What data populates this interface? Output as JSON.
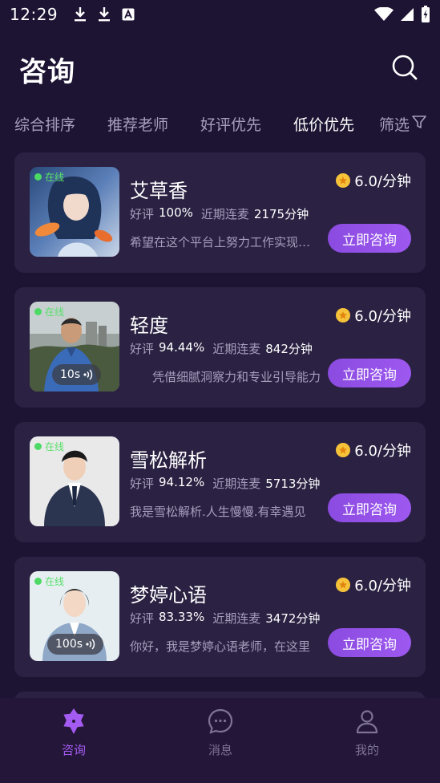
{
  "status_bar": {
    "time": "12:29",
    "left_icons": [
      "download-icon",
      "download-icon",
      "font-icon"
    ],
    "right_icons": [
      "wifi-icon",
      "signal-icon",
      "battery-charging-icon"
    ]
  },
  "header": {
    "title": "咨询",
    "search_icon": "search-icon"
  },
  "tabs": [
    {
      "label": "综合排序",
      "active": false
    },
    {
      "label": "推荐老师",
      "active": false
    },
    {
      "label": "好评优先",
      "active": false
    },
    {
      "label": "低价优先",
      "active": true
    }
  ],
  "filter": {
    "label": "筛选",
    "icon": "filter-icon"
  },
  "consultants": [
    {
      "name": "艾草香",
      "online_label": "在线",
      "price": "6.0/分钟",
      "rating_label": "好评",
      "rating": "100%",
      "streak_label": "近期连麦",
      "streak": "2175分钟",
      "description": "希望在这个平台上努力工作实现自我价值",
      "button": "立即咨询"
    },
    {
      "name": "轻度",
      "online_label": "在线",
      "audio": "10s",
      "price": "6.0/分钟",
      "rating_label": "好评",
      "rating": "94.44%",
      "streak_label": "近期连麦",
      "streak": "842分钟",
      "description": "凭借细腻洞察力和专业引导能力",
      "button": "立即咨询"
    },
    {
      "name": "雪松解析",
      "online_label": "在线",
      "price": "6.0/分钟",
      "rating_label": "好评",
      "rating": "94.12%",
      "streak_label": "近期连麦",
      "streak": "5713分钟",
      "description": "我是雪松解析.人生慢慢.有幸遇见",
      "button": "立即咨询"
    },
    {
      "name": "梦婷心语",
      "online_label": "在线",
      "audio": "100s",
      "price": "6.0/分钟",
      "rating_label": "好评",
      "rating": "83.33%",
      "streak_label": "近期连麦",
      "streak": "3472分钟",
      "description": "你好，我是梦婷心语老师，在这里",
      "button": "立即咨询"
    }
  ],
  "bottom_nav": [
    {
      "label": "咨询",
      "icon": "star-badge-icon",
      "active": true
    },
    {
      "label": "消息",
      "icon": "chat-bubble-icon",
      "active": false
    },
    {
      "label": "我的",
      "icon": "person-icon",
      "active": false
    }
  ],
  "colors": {
    "background": "#1d1333",
    "card": "#2b2142",
    "accent": "#9d58f0",
    "muted_text": "#a79dbd",
    "online_green": "#4cd964",
    "coin_gold": "#f6c23a"
  }
}
